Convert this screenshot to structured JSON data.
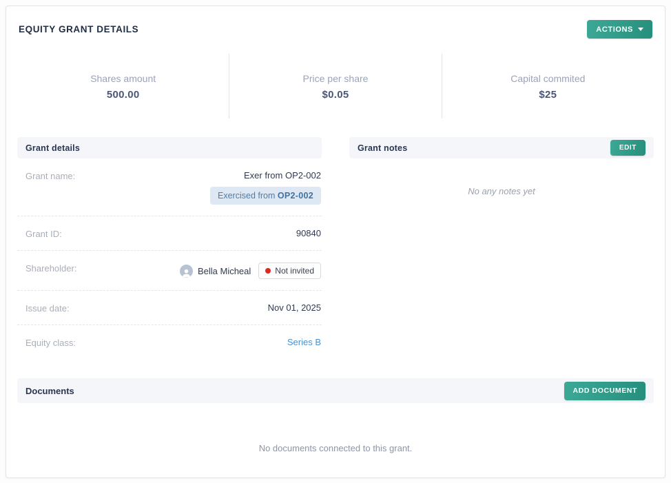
{
  "page": {
    "title": "EQUITY GRANT DETAILS"
  },
  "actions_button": {
    "label": "ACTIONS"
  },
  "stats": [
    {
      "label": "Shares amount",
      "value": "500.00"
    },
    {
      "label": "Price per share",
      "value": "$0.05"
    },
    {
      "label": "Capital commited",
      "value": "$25"
    }
  ],
  "grant_details": {
    "title": "Grant details",
    "rows": {
      "grant_name": {
        "label": "Grant name:",
        "value": "Exer from OP2-002",
        "badge_prefix": "Exercised from ",
        "badge_code": "OP2-002"
      },
      "grant_id": {
        "label": "Grant ID:",
        "value": "90840"
      },
      "shareholder": {
        "label": "Shareholder:",
        "name": "Bella Micheal",
        "status": "Not invited"
      },
      "issue_date": {
        "label": "Issue date:",
        "value": "Nov 01, 2025"
      },
      "equity_class": {
        "label": "Equity class:",
        "value": "Series B"
      }
    }
  },
  "grant_notes": {
    "title": "Grant notes",
    "edit_button": "EDIT",
    "empty_text": "No any notes yet"
  },
  "documents": {
    "title": "Documents",
    "add_button": "ADD DOCUMENT",
    "empty_text": "No documents connected to this grant."
  },
  "colors": {
    "accent_teal": "#2f9a87",
    "link_blue": "#4b8fca",
    "badge_blue_bg": "#dde8f4",
    "badge_blue_text": "#527ba3",
    "status_red_dot": "#de2a1b",
    "section_header_bg": "#f4f6fa",
    "label_gray": "#a8aeba",
    "value_dark": "#2f3a4e"
  }
}
